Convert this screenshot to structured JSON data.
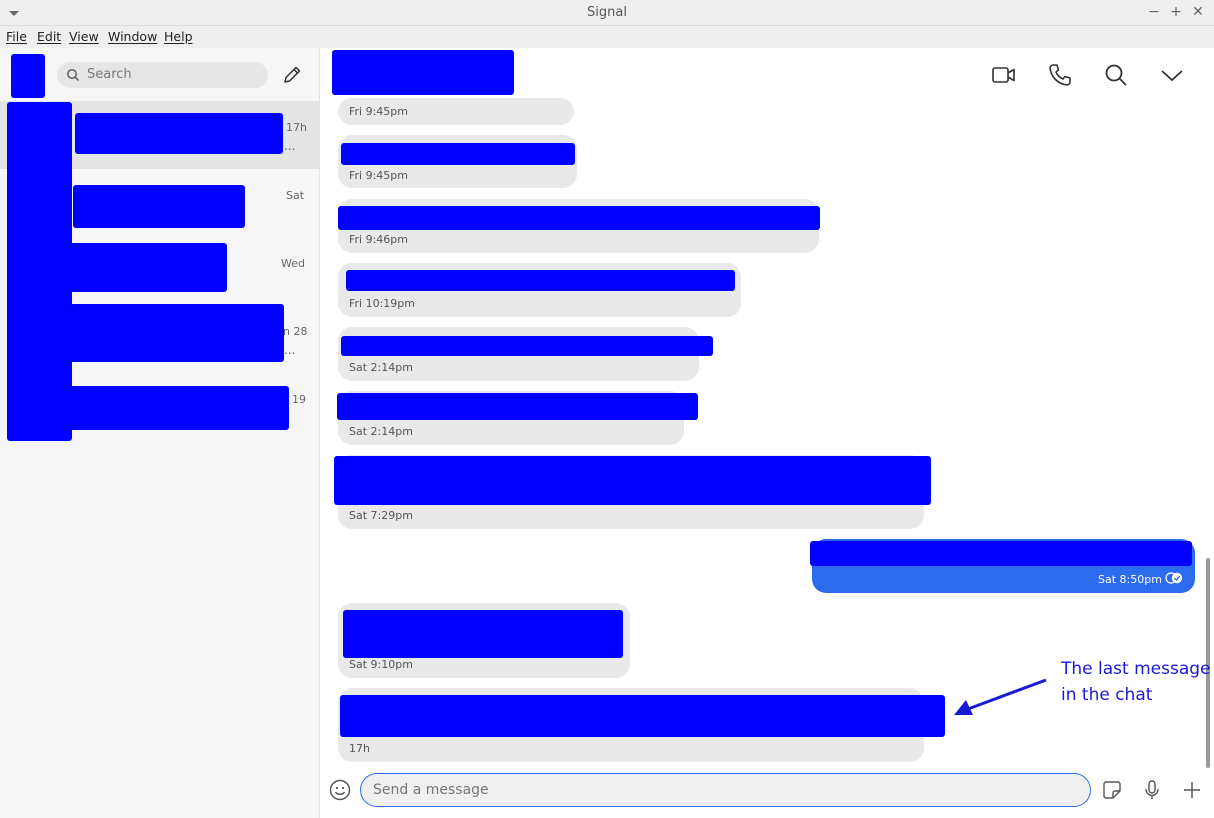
{
  "window": {
    "title": "Signal"
  },
  "menu": {
    "file": "File",
    "edit": "Edit",
    "view": "View",
    "window": "Window",
    "help": "Help"
  },
  "sidebar": {
    "search_placeholder": "Search",
    "conversations": [
      {
        "time": "17h",
        "preview_tail": "..."
      },
      {
        "time": "Sat"
      },
      {
        "time": "Wed"
      },
      {
        "time": "n 28",
        "preview_tail": "..."
      },
      {
        "time": "19"
      }
    ]
  },
  "messages": [
    {
      "time": "Fri 9:45pm",
      "direction": "in"
    },
    {
      "time": "Fri 9:45pm",
      "direction": "in"
    },
    {
      "time": "Fri 9:46pm",
      "direction": "in"
    },
    {
      "time": "Fri 10:19pm",
      "direction": "in"
    },
    {
      "time": "Sat 2:14pm",
      "direction": "in"
    },
    {
      "time": "Sat 2:14pm",
      "direction": "in"
    },
    {
      "time": "Sat 7:29pm",
      "direction": "in"
    },
    {
      "time": "Sat 8:50pm",
      "direction": "out",
      "status": "read"
    },
    {
      "time": "Sat 9:10pm",
      "direction": "in"
    },
    {
      "time": "17h",
      "direction": "in"
    }
  ],
  "annotation": {
    "line1": "The last message",
    "line2": "in the chat"
  },
  "composer": {
    "placeholder": "Send a message"
  },
  "colors": {
    "redaction": "#0000ff",
    "accent": "#2c6bed",
    "annotation": "#1a1ad4"
  },
  "icons": [
    "video-call-icon",
    "voice-call-icon",
    "search-icon",
    "chevron-down-icon",
    "compose-icon",
    "emoji-icon",
    "sticker-icon",
    "microphone-icon",
    "plus-icon"
  ]
}
